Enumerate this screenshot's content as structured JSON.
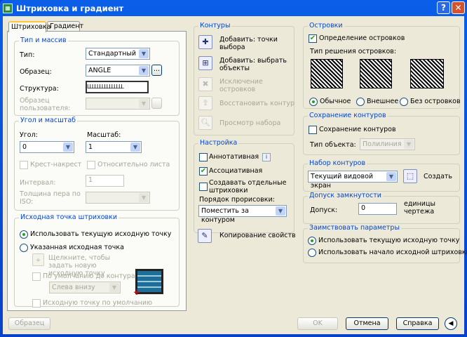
{
  "title": "Штриховка и градиент",
  "titlebar": {
    "help": "?",
    "close": "✕"
  },
  "tabs": [
    "Штриховка",
    "Градиент"
  ],
  "type_group": {
    "legend": "Тип и массив",
    "type_label": "Тип:",
    "type_value": "Стандартный",
    "pattern_label": "Образец:",
    "pattern_value": "ANGLE",
    "browse": "...",
    "swatch_label": "Структура:",
    "swatch_text": "LLLLLLLLLLLLLLL",
    "custom_label": "Образец пользователя:"
  },
  "angle_group": {
    "legend": "Угол и масштаб",
    "angle_label": "Угол:",
    "angle_value": "0",
    "scale_label": "Масштаб:",
    "scale_value": "1",
    "double": "Крест-накрест",
    "relative": "Относительно листа",
    "spacing_label": "Интервал:",
    "spacing_value": "1",
    "iso_label": "Толщина пера по ISO:"
  },
  "origin_group": {
    "legend": "Исходная точка штриховки",
    "use_current": "Использовать текущую исходную точку",
    "specified": "Указанная исходная точка",
    "click_text": "Щелкните, чтобы задать новую исходную точку",
    "default_boundary": "По умолчанию до контура",
    "position": "Слева внизу",
    "store_default": "Исходную точку по умолчанию"
  },
  "preview_button": "Образец",
  "boundaries": {
    "legend": "Контуры",
    "items": [
      "Добавить: точки выбора",
      "Добавить: выбрать объекты",
      "Исключение островков",
      "Восстановить контур",
      "Просмотр набора"
    ]
  },
  "options": {
    "legend": "Настройка",
    "annotative": "Аннотативная",
    "info": "i",
    "associative": "Ассоциативная",
    "separate": "Создавать отдельные штриховки",
    "draw_order_label": "Порядок прорисовки:",
    "draw_order_value": "Поместить за контуром"
  },
  "inherit": "Копирование свойств",
  "islands": {
    "legend": "Островки",
    "detection": "Определение островков",
    "style_label": "Тип решения островков:",
    "styles": [
      "Обычное",
      "Внешнее",
      "Без островков"
    ]
  },
  "retain": {
    "legend": "Сохранение контуров",
    "retain": "Сохранение контуров",
    "object_type_label": "Тип объекта:",
    "object_type_value": "Полилиния"
  },
  "boundary_set": {
    "legend": "Набор контуров",
    "value": "Текущий видовой экран",
    "new": "Создать"
  },
  "gap": {
    "legend": "Допуск замкнутости",
    "label": "Допуск:",
    "value": "0",
    "units": "единицы чертежа"
  },
  "inherit_options": {
    "legend": "Заимствовать параметры",
    "use_current": "Использовать текущую исходную точку",
    "use_source": "Использовать начало исходной штриховки"
  },
  "buttons": {
    "ok": "OK",
    "cancel": "Отмена",
    "help": "Справка",
    "more": "◀"
  }
}
